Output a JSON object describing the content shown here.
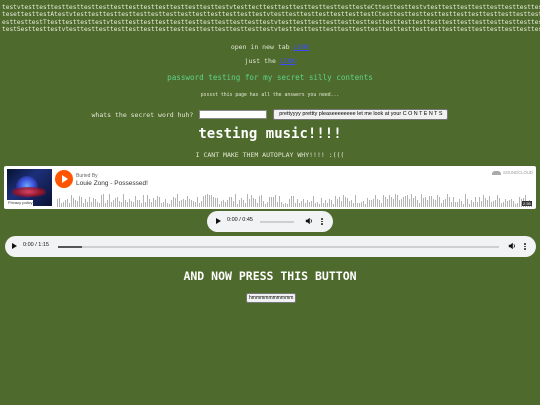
{
  "background_lines": [
    "testvtesttesttesttesttesttesttesttesttesttesttesttesttesttestvtesttecttesttesttesttesttesttesttesteCttesttesttestvtesttesttesttesttesttesttesttesttest",
    "tesettesttestAtestvtesttesttesttesttesttesttesttesttesttesttesttesttestvtesttesttesttesttesttesttestCtesttesttesttesttesttesttesttesttesttesttesttest",
    "esttesttestTtesttesttesttestvtesttesttesttesttesttesttesttesttesttesttestvtesttesttesttesttesttesttesttesttesttesttesttesttesttesttesttesttesttest",
    "testSesttesttestvtesttesttesttesttesttesttesttesttesttesttesttesttesttestvtesttesttesttesttesttesttesttesttesttesttesttesttesttesttesttesttesttest"
  ],
  "links": [
    {
      "text": "open in new tab",
      "link": "LINK"
    },
    {
      "text": "just the",
      "link": "LINK"
    }
  ],
  "password_title": "password testing for my secret silly contents",
  "password_note": "psssst this page has all the answers you need...",
  "secret_prompt": "whats the secret word huh?",
  "secret_input_value": "",
  "secret_button": "prettyyyy prettty pleaseeeeeeee let me look at your C O N T E N T S",
  "music_heading": "testing music!!!!",
  "autoplay_note": "I CANT MAKE THEM AUTOPLAY WHY!!!! :(((",
  "soundcloud": {
    "artist": "Buried By",
    "title": "Louie Zong - Possessed!",
    "brand": "SOUNDCLOUD",
    "privacy": "Privacy policy",
    "duration": "2:55",
    "accent": "#ff5500"
  },
  "audio_players": [
    {
      "time": "0:00 / 0:45",
      "progress": 0
    },
    {
      "time": "0:00 / 1:15",
      "progress": 0
    }
  ],
  "press_heading": "AND NOW PRESS THIS BUTTON",
  "hmm_button": "hmmmmmmmmmm",
  "colors": {
    "background": "#4f6a2d",
    "password_title": "#5fd38a",
    "link": "#3b4cff"
  }
}
